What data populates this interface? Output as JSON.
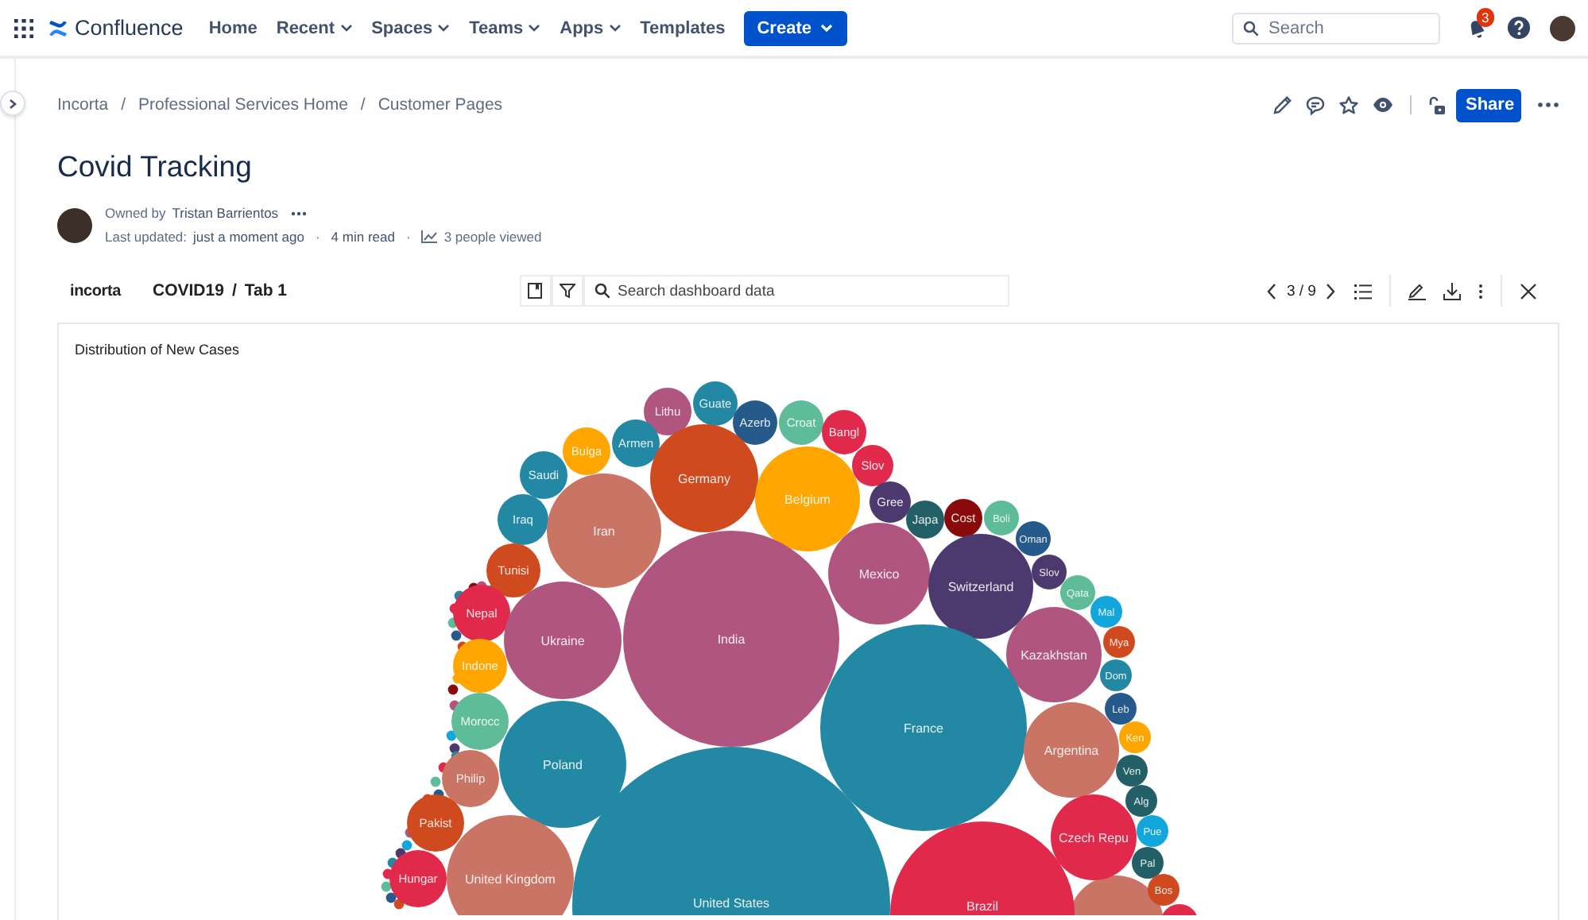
{
  "nav": {
    "logo": "Confluence",
    "items": [
      {
        "label": "Home",
        "dropdown": false
      },
      {
        "label": "Recent",
        "dropdown": true
      },
      {
        "label": "Spaces",
        "dropdown": true
      },
      {
        "label": "Teams",
        "dropdown": true
      },
      {
        "label": "Apps",
        "dropdown": true
      },
      {
        "label": "Templates",
        "dropdown": false
      }
    ],
    "create": "Create",
    "search": {
      "placeholder": "Search"
    },
    "notifications": "3"
  },
  "breadcrumbs": {
    "separator": "/",
    "items": [
      "Incorta",
      "Professional Services Home",
      "Customer Pages"
    ]
  },
  "share": "Share",
  "page": {
    "bullet": "·",
    "title": "Covid Tracking",
    "owned_by": "Owned by",
    "owner": "Tristan Barrientos",
    "updated_label": "Last updated:",
    "updated": "just a moment ago",
    "read_time": "4 min read",
    "views": "3 people viewed"
  },
  "dashboard": {
    "logo": "incorta",
    "name": "COVID19",
    "separator": "/",
    "tab": "Tab 1",
    "search": {
      "placeholder": "Search dashboard data"
    },
    "pager": "3 / 9",
    "chart": {
      "title": "Distribution of New Cases",
      "bubbles": [
        {
          "label": "Lithu",
          "color": "#b05580"
        },
        {
          "label": "Guate",
          "color": "#2288a3"
        },
        {
          "label": "Azerb",
          "color": "#255a8a"
        },
        {
          "label": "Croat",
          "color": "#5ebd98"
        },
        {
          "label": "Bangl",
          "color": "#e0294b"
        },
        {
          "label": "Slov",
          "color": "#e0294b"
        },
        {
          "label": "Bulga",
          "color": "#ffa600"
        },
        {
          "label": "Armen",
          "color": "#2288a3"
        },
        {
          "label": "Germany",
          "color": "#cf4a1f"
        },
        {
          "label": "Belgium",
          "color": "#ffa600"
        },
        {
          "label": "Saudi",
          "color": "#2288a3"
        },
        {
          "label": "Iraq",
          "color": "#2288a3"
        },
        {
          "label": "Iran",
          "color": "#c97464"
        },
        {
          "label": "Gree",
          "color": "#4c3a6e"
        },
        {
          "label": "Japa",
          "color": "#225f66"
        },
        {
          "label": "Cost",
          "color": "#8a0b0b"
        },
        {
          "label": "Boli",
          "color": "#5ebd98"
        },
        {
          "label": "Oman",
          "color": "#255a8a"
        },
        {
          "label": "Tunisi",
          "color": "#cf4a1f"
        },
        {
          "label": "Mexico",
          "color": "#b05580"
        },
        {
          "label": "Switzerland",
          "color": "#4c3a6e"
        },
        {
          "label": "Slov",
          "color": "#4c3a6e"
        },
        {
          "label": "Qata",
          "color": "#5ebd98"
        },
        {
          "label": "Mal",
          "color": "#13a6dc"
        },
        {
          "label": "Nepal",
          "color": "#e0294b"
        },
        {
          "label": "Ukraine",
          "color": "#b05580"
        },
        {
          "label": "India",
          "color": "#b05580"
        },
        {
          "label": "Kazakhstan",
          "color": "#b05580"
        },
        {
          "label": "Mya",
          "color": "#cf4a1f"
        },
        {
          "label": "Indone",
          "color": "#ffa600"
        },
        {
          "label": "Dom",
          "color": "#2288a3"
        },
        {
          "label": "France",
          "color": "#2288a3"
        },
        {
          "label": "Leb",
          "color": "#255a8a"
        },
        {
          "label": "Morocc",
          "color": "#5ebd98"
        },
        {
          "label": "Argentina",
          "color": "#c97464"
        },
        {
          "label": "Ken",
          "color": "#ffa600"
        },
        {
          "label": "Ven",
          "color": "#225f66"
        },
        {
          "label": "Poland",
          "color": "#2288a3"
        },
        {
          "label": "Philip",
          "color": "#c97464"
        },
        {
          "label": "Alg",
          "color": "#225f66"
        },
        {
          "label": "Czech Repu",
          "color": "#e0294b"
        },
        {
          "label": "Pue",
          "color": "#13a6dc"
        },
        {
          "label": "Pakist",
          "color": "#cf4a1f"
        },
        {
          "label": "Pal",
          "color": "#225f66"
        },
        {
          "label": "United Kingdom",
          "color": "#c97464"
        },
        {
          "label": "United States",
          "color": "#2288a3"
        },
        {
          "label": "Brazil",
          "color": "#e0294b"
        },
        {
          "label": "Hungar",
          "color": "#e0294b"
        },
        {
          "label": "Bos",
          "color": "#cf4a1f"
        }
      ]
    }
  }
}
